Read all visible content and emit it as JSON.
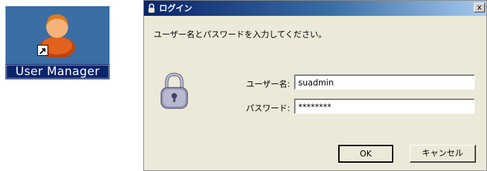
{
  "desktop": {
    "shortcut_label": "User Manager",
    "icon": "user-person-icon",
    "overlay_icon": "shortcut-arrow-icon"
  },
  "dialog": {
    "title": "ログイン",
    "title_icon": "lock-icon",
    "close_label": "x",
    "prompt": "ユーザー名とパスワードを入力してください。",
    "username_label": "ユーザー名:",
    "username_value": "suadmin",
    "password_label": "パスワード:",
    "password_value": "********",
    "ok_label": "OK",
    "cancel_label": "キャンセル"
  },
  "colors": {
    "titlebar_start": "#0a246a",
    "titlebar_end": "#a6caf0",
    "dialog_bg": "#ece9d8",
    "desktop_bg": "#3a6ea5",
    "selection_bg": "#0a246a"
  }
}
